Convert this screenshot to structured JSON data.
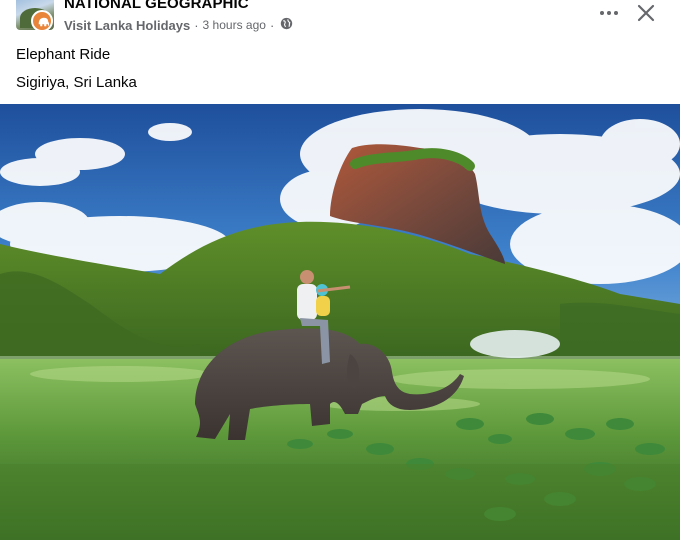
{
  "post": {
    "page_name": "NATIONAL GEOGRAPHIC",
    "source": "Visit Lanka Holidays",
    "separator": "·",
    "time": "3 hours ago",
    "privacy_icon": "globe-icon",
    "more_icon": "more-options-icon",
    "close_icon": "close-icon",
    "text_lines": [
      "Elephant Ride",
      "Sigiriya, Sri Lanka"
    ]
  },
  "colors": {
    "text_primary": "#050505",
    "text_secondary": "#65676b",
    "badge": "#e8853a"
  }
}
